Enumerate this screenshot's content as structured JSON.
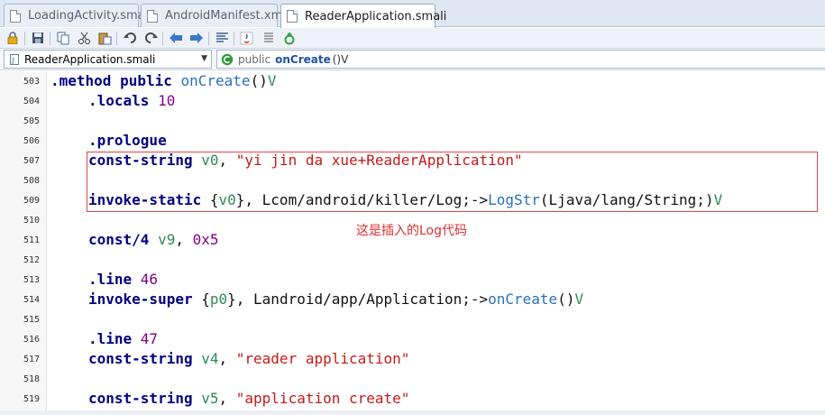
{
  "tabs": [
    {
      "label": "LoadingActivity.smali",
      "active": false
    },
    {
      "label": "AndroidManifest.xml",
      "active": false
    },
    {
      "label": "ReaderApplication.smali",
      "active": true
    }
  ],
  "selectors": {
    "file": "ReaderApplication.smali",
    "method_modifier": "public",
    "method_name": "onCreate",
    "method_sig": "()V"
  },
  "toolbar": {
    "buttons": [
      "lock-icon",
      "save-icon",
      "copy-icon",
      "cut-icon",
      "paste-icon",
      "undo-icon",
      "redo-icon",
      "back-arrow-icon",
      "forward-arrow-icon",
      "format-icon",
      "java-icon",
      "list-icon",
      "recycle-icon"
    ]
  },
  "editor": {
    "lines": [
      {
        "n": "503",
        "parts": [
          {
            "t": ".method public ",
            "c": "kwd"
          },
          {
            "t": "onCreate",
            "c": "meth"
          },
          {
            "t": "()",
            "c": "plain"
          },
          {
            "t": "V",
            "c": "vt"
          }
        ],
        "indent": false
      },
      {
        "n": "504",
        "parts": [
          {
            "t": ".locals ",
            "c": "kwd"
          },
          {
            "t": "10",
            "c": "num"
          }
        ],
        "indent": true
      },
      {
        "n": "505",
        "parts": [],
        "indent": true
      },
      {
        "n": "506",
        "parts": [
          {
            "t": ".prologue",
            "c": "kwd"
          }
        ],
        "indent": true
      },
      {
        "n": "507",
        "parts": [
          {
            "t": "const-string ",
            "c": "kwd"
          },
          {
            "t": "v0",
            "c": "reg"
          },
          {
            "t": ", ",
            "c": "plain"
          },
          {
            "t": "\"yi jin da xue+ReaderApplication\"",
            "c": "str"
          }
        ],
        "indent": true
      },
      {
        "n": "508",
        "parts": [],
        "indent": true
      },
      {
        "n": "509",
        "parts": [
          {
            "t": "invoke-static ",
            "c": "kwd"
          },
          {
            "t": "{",
            "c": "plain"
          },
          {
            "t": "v0",
            "c": "reg"
          },
          {
            "t": "}, Lcom/android/killer/Log;->",
            "c": "plain"
          },
          {
            "t": "LogStr",
            "c": "meth"
          },
          {
            "t": "(Ljava/lang/String;)",
            "c": "plain"
          },
          {
            "t": "V",
            "c": "vt"
          }
        ],
        "indent": true
      },
      {
        "n": "510",
        "parts": [],
        "indent": true
      },
      {
        "n": "511",
        "parts": [
          {
            "t": "const/4 ",
            "c": "kwd"
          },
          {
            "t": "v9",
            "c": "reg"
          },
          {
            "t": ", ",
            "c": "plain"
          },
          {
            "t": "0x5",
            "c": "num"
          }
        ],
        "indent": true
      },
      {
        "n": "512",
        "parts": [],
        "indent": true
      },
      {
        "n": "513",
        "parts": [
          {
            "t": ".line ",
            "c": "kwd"
          },
          {
            "t": "46",
            "c": "num"
          }
        ],
        "indent": true
      },
      {
        "n": "514",
        "parts": [
          {
            "t": "invoke-super ",
            "c": "kwd"
          },
          {
            "t": "{",
            "c": "plain"
          },
          {
            "t": "p0",
            "c": "reg"
          },
          {
            "t": "}, Landroid/app/Application;->",
            "c": "plain"
          },
          {
            "t": "onCreate",
            "c": "meth"
          },
          {
            "t": "()",
            "c": "plain"
          },
          {
            "t": "V",
            "c": "vt"
          }
        ],
        "indent": true
      },
      {
        "n": "515",
        "parts": [],
        "indent": true
      },
      {
        "n": "516",
        "parts": [
          {
            "t": ".line ",
            "c": "kwd"
          },
          {
            "t": "47",
            "c": "num"
          }
        ],
        "indent": true
      },
      {
        "n": "517",
        "parts": [
          {
            "t": "const-string ",
            "c": "kwd"
          },
          {
            "t": "v4",
            "c": "reg"
          },
          {
            "t": ", ",
            "c": "plain"
          },
          {
            "t": "\"reader application\"",
            "c": "str"
          }
        ],
        "indent": true
      },
      {
        "n": "518",
        "parts": [],
        "indent": true
      },
      {
        "n": "519",
        "parts": [
          {
            "t": "const-string ",
            "c": "kwd"
          },
          {
            "t": "v5",
            "c": "reg"
          },
          {
            "t": ", ",
            "c": "plain"
          },
          {
            "t": "\"application create\"",
            "c": "str"
          }
        ],
        "indent": true
      }
    ],
    "annotation": "这是插入的Log代码"
  },
  "colors": {
    "highlight_border": "#e64545",
    "annotation_text": "#e03030"
  }
}
